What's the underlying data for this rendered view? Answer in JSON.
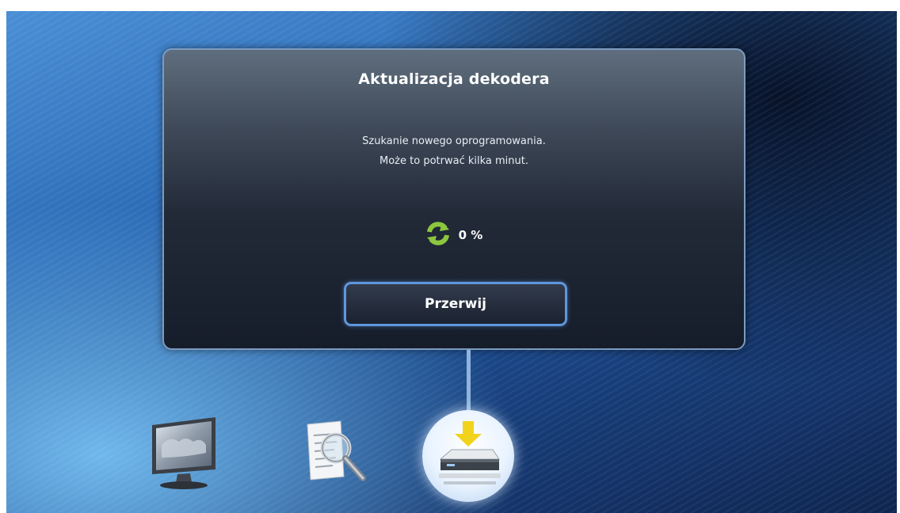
{
  "dialog": {
    "title": "Aktualizacja dekodera",
    "message_line1": "Szukanie nowego oprogramowania.",
    "message_line2": "Może to potrwać kilka minut.",
    "progress_text": "0 %",
    "progress_value": 0,
    "abort_label": "Przerwij"
  },
  "icons": {
    "progress": "refresh-icon",
    "menu": [
      "tv-icon",
      "search-document-icon",
      "decoder-download-icon"
    ]
  },
  "colors": {
    "accent_green": "#8cc63f",
    "button_border": "#5f97dc",
    "download_arrow": "#f2d31b"
  }
}
